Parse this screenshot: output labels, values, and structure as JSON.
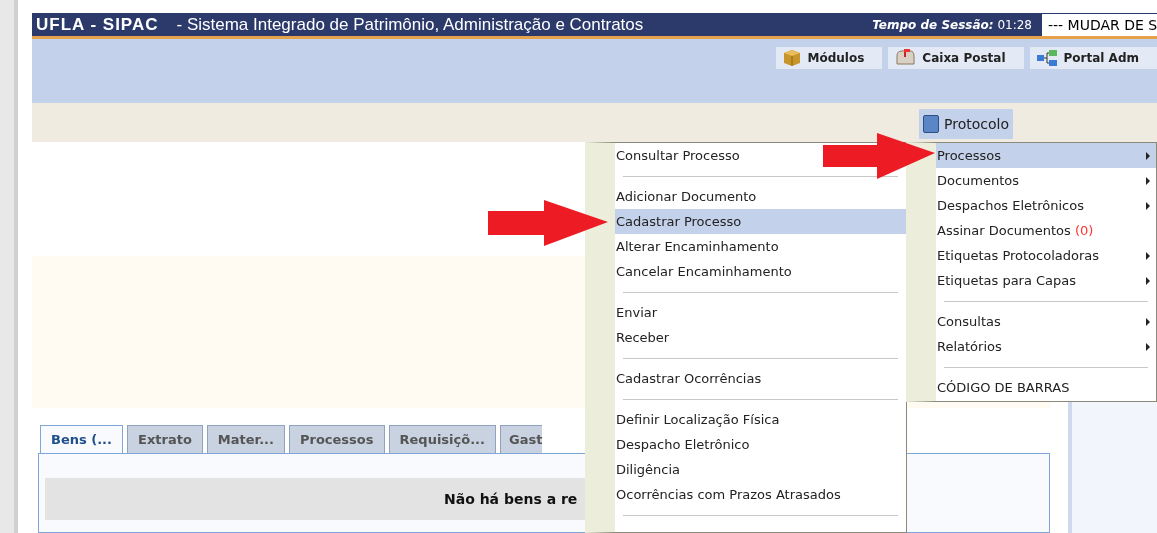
{
  "header": {
    "system": "UFLA - SIPAC",
    "subtitle": "- Sistema Integrado de Patrimônio, Administração e Contratos",
    "session_label": "Tempo de Sessão:",
    "session_time": "01:28",
    "unit_select": "--- MUDAR DE S"
  },
  "toolbar": [
    {
      "label": "Módulos",
      "kind": "box"
    },
    {
      "label": "Caixa Postal",
      "kind": "mailbox"
    },
    {
      "label": "Portal Adm",
      "kind": "network"
    }
  ],
  "module_tab": {
    "label": "Protocolo"
  },
  "submenu": [
    {
      "kind": "item",
      "label": "Consultar Processo",
      "selected": false
    },
    {
      "kind": "separator"
    },
    {
      "kind": "item",
      "label": "Adicionar Documento",
      "selected": false
    },
    {
      "kind": "item",
      "label": "Cadastrar Processo",
      "selected": true
    },
    {
      "kind": "item",
      "label": "Alterar Encaminhamento",
      "selected": false
    },
    {
      "kind": "item",
      "label": "Cancelar Encaminhamento",
      "selected": false
    },
    {
      "kind": "separator"
    },
    {
      "kind": "item",
      "label": "Enviar",
      "selected": false
    },
    {
      "kind": "item",
      "label": "Receber",
      "selected": false
    },
    {
      "kind": "separator"
    },
    {
      "kind": "item",
      "label": "Cadastrar Ocorrências",
      "selected": false
    },
    {
      "kind": "separator"
    },
    {
      "kind": "item",
      "label": "Definir Localização Física",
      "selected": false
    },
    {
      "kind": "item",
      "label": "Despacho Eletrônico",
      "selected": false
    },
    {
      "kind": "item",
      "label": "Diligência",
      "selected": false
    },
    {
      "kind": "item",
      "label": "Ocorrências com Prazos Atrasados",
      "selected": false
    },
    {
      "kind": "separator"
    }
  ],
  "menu": [
    {
      "kind": "item",
      "label": "Processos",
      "has_submenu": true,
      "selected": true
    },
    {
      "kind": "item",
      "label": "Documentos",
      "has_submenu": true,
      "selected": false
    },
    {
      "kind": "item",
      "label": "Despachos Eletrônicos",
      "has_submenu": true,
      "selected": false
    },
    {
      "kind": "item",
      "label": "Assinar Documentos",
      "count": "(0)",
      "has_submenu": false,
      "selected": false
    },
    {
      "kind": "item",
      "label": "Etiquetas Protocoladoras",
      "has_submenu": true,
      "selected": false
    },
    {
      "kind": "item",
      "label": "Etiquetas para Capas",
      "has_submenu": true,
      "selected": false
    },
    {
      "kind": "separator"
    },
    {
      "kind": "item",
      "label": "Consultas",
      "has_submenu": true,
      "selected": false
    },
    {
      "kind": "item",
      "label": "Relatórios",
      "has_submenu": true,
      "selected": false
    },
    {
      "kind": "separator"
    },
    {
      "kind": "item",
      "label": "CÓDIGO DE BARRAS",
      "has_submenu": false,
      "selected": false
    }
  ],
  "content_tabs": [
    {
      "label": "Bens (...",
      "selected": true
    },
    {
      "label": "Extrato",
      "selected": false
    },
    {
      "label": "Mater...",
      "selected": false
    },
    {
      "label": "Processos",
      "selected": false
    },
    {
      "label": "Requisiçõ...",
      "selected": false
    },
    {
      "label": "Gast",
      "selected": false
    }
  ],
  "content_message": "Não há bens a re"
}
